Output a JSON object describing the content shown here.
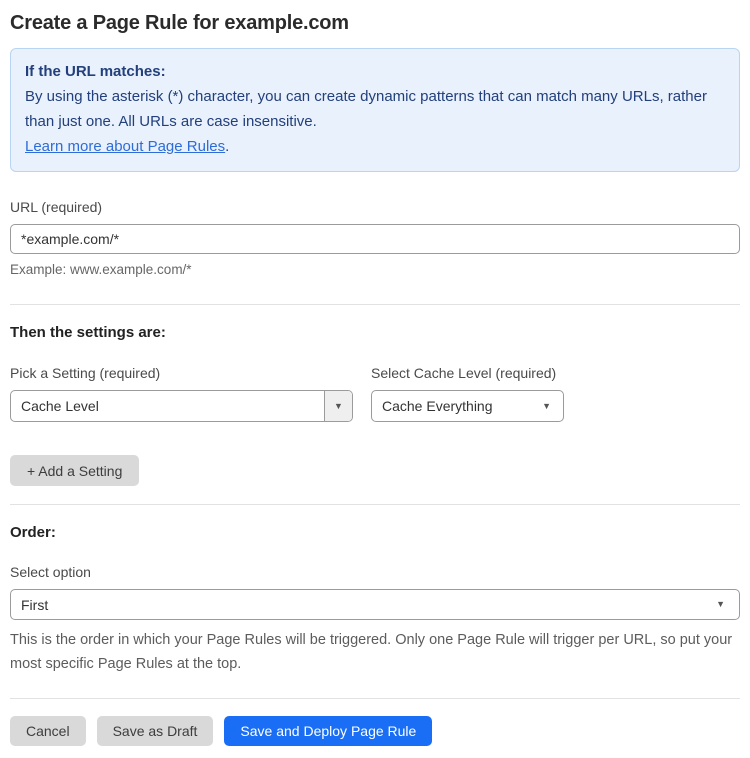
{
  "page": {
    "title": "Create a Page Rule for example.com"
  },
  "notice": {
    "heading": "If the URL matches:",
    "body": "By using the asterisk (*) character, you can create dynamic patterns that can match many URLs, rather than just one. All URLs are case insensitive.",
    "link_label": "Learn more about Page Rules",
    "link_suffix": "."
  },
  "url_field": {
    "label": "URL (required)",
    "value": "*example.com/*",
    "helper": "Example: www.example.com/*"
  },
  "settings": {
    "heading": "Then the settings are:",
    "setting_label": "Pick a Setting (required)",
    "setting_value": "Cache Level",
    "cache_label": "Select Cache Level (required)",
    "cache_value": "Cache Everything",
    "add_button_label": "+ Add a Setting"
  },
  "order": {
    "heading": "Order:",
    "label": "Select option",
    "value": "First",
    "helper": "This is the order in which your Page Rules will be triggered. Only one Page Rule will trigger per URL, so put your most specific Page Rules at the top."
  },
  "footer": {
    "cancel_label": "Cancel",
    "save_draft_label": "Save as Draft",
    "save_deploy_label": "Save and Deploy Page Rule"
  },
  "icons": {
    "dropdown_arrow": "▼"
  },
  "colors": {
    "accent_blue": "#1a6ef5",
    "notice_bg": "#e8f1fc",
    "notice_border": "#bad4f3",
    "notice_text": "#23407c",
    "link_blue": "#2d6cd9",
    "button_gray": "#d9d9d9"
  }
}
